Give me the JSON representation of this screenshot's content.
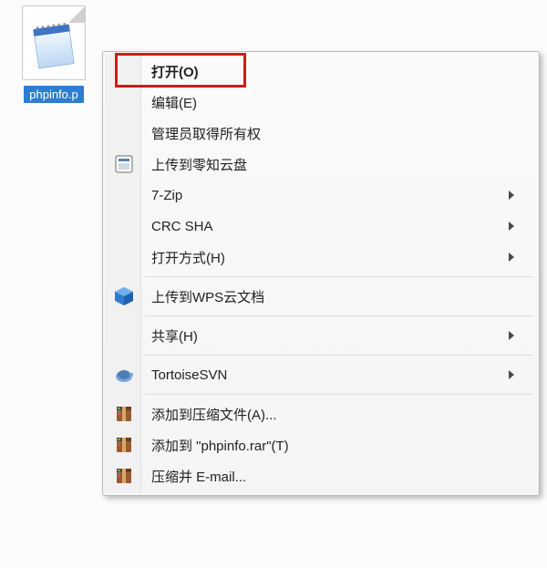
{
  "file": {
    "label": "phpinfo.p"
  },
  "menu": {
    "open": "打开(O)",
    "edit": "编辑(E)",
    "admin_own": "管理员取得所有权",
    "upload_lingzhi": "上传到零知云盘",
    "sevenzip": "7-Zip",
    "crcsha": "CRC SHA",
    "open_with": "打开方式(H)",
    "upload_wps": "上传到WPS云文档",
    "share": "共享(H)",
    "tortoise": "TortoiseSVN",
    "rar_add": "添加到压缩文件(A)...",
    "rar_add_named": "添加到 \"phpinfo.rar\"(T)",
    "rar_email": "压缩并 E-mail..."
  }
}
